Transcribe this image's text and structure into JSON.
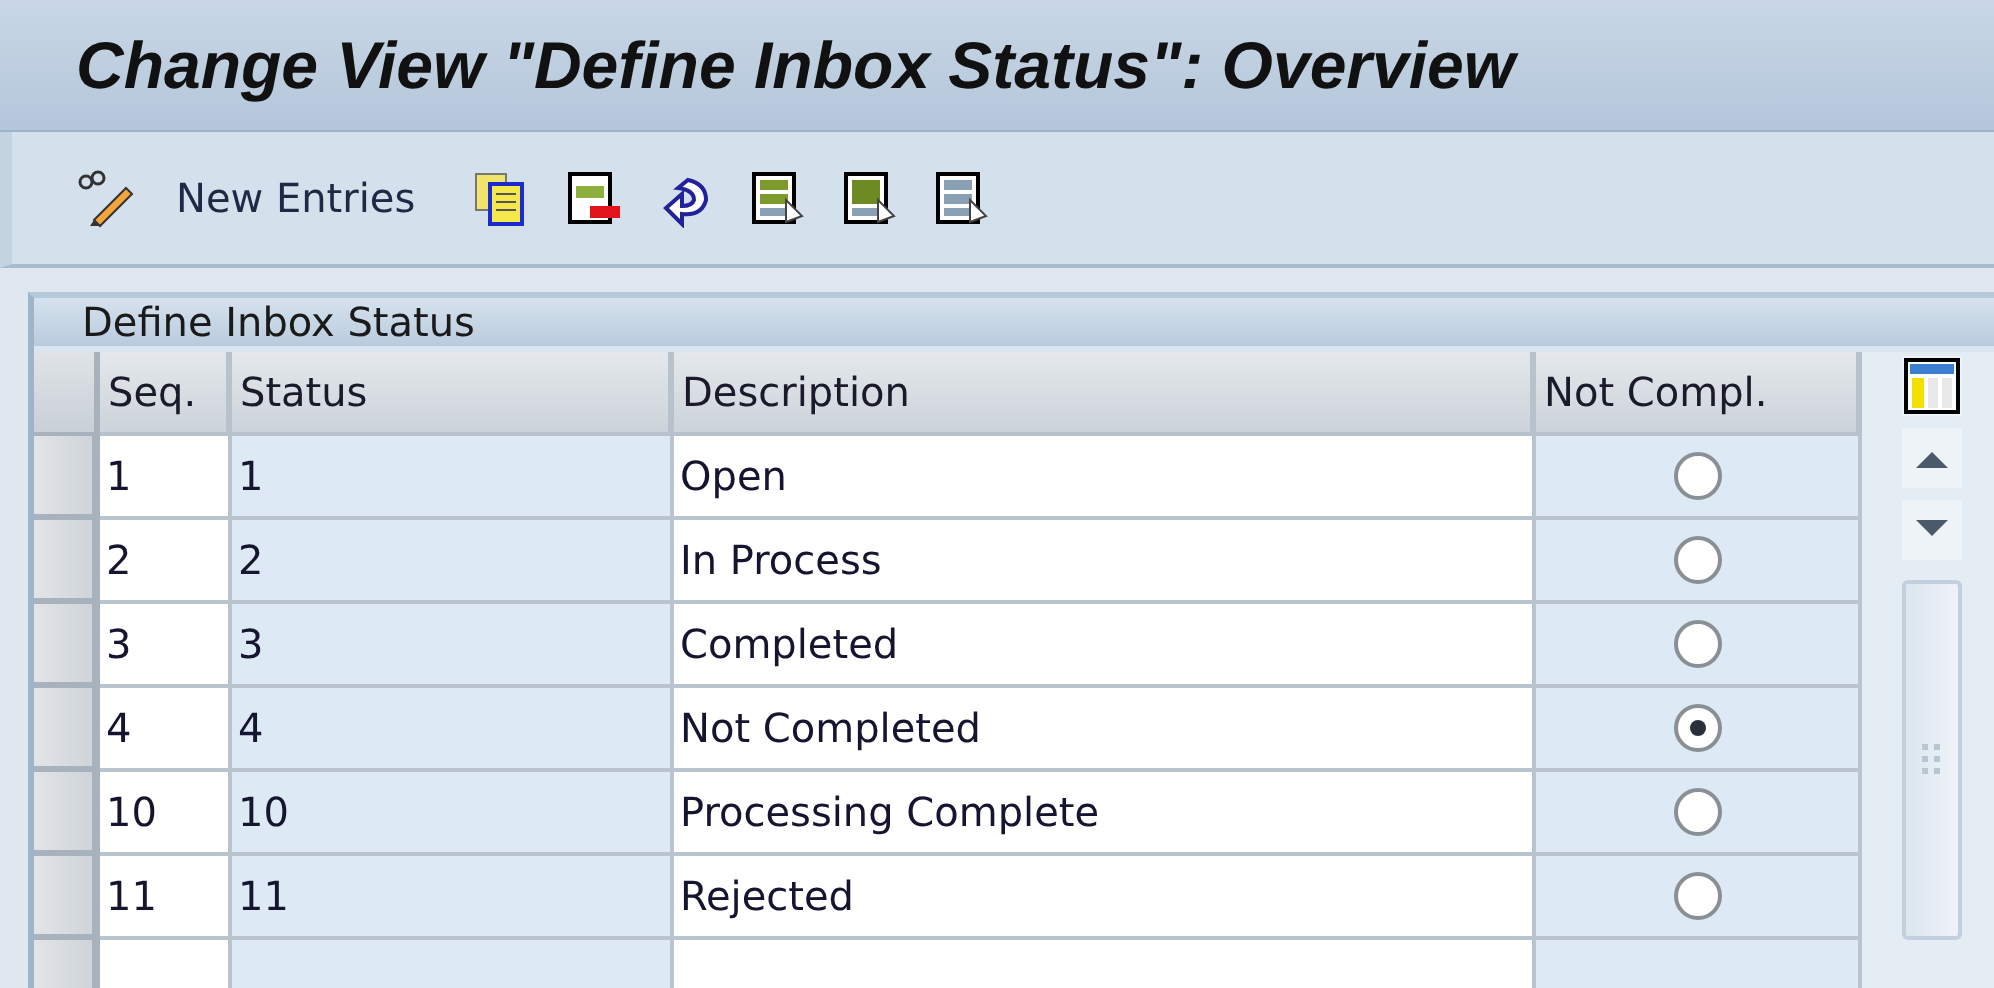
{
  "window": {
    "title": "Change View \"Define Inbox Status\": Overview"
  },
  "toolbar": {
    "new_entries": "New Entries"
  },
  "panel": {
    "title": "Define Inbox Status"
  },
  "table": {
    "columns": [
      "Seq.",
      "Status",
      "Description",
      "Not Compl."
    ],
    "rows": [
      {
        "seq": "1",
        "status": "1",
        "description": "Open",
        "selected": false
      },
      {
        "seq": "2",
        "status": "2",
        "description": "In Process",
        "selected": false
      },
      {
        "seq": "3",
        "status": "3",
        "description": "Completed",
        "selected": false
      },
      {
        "seq": "4",
        "status": "4",
        "description": "Not Completed",
        "selected": true
      },
      {
        "seq": "10",
        "status": "10",
        "description": "Processing Complete",
        "selected": false
      },
      {
        "seq": "11",
        "status": "11",
        "description": "Rejected",
        "selected": false
      }
    ]
  }
}
